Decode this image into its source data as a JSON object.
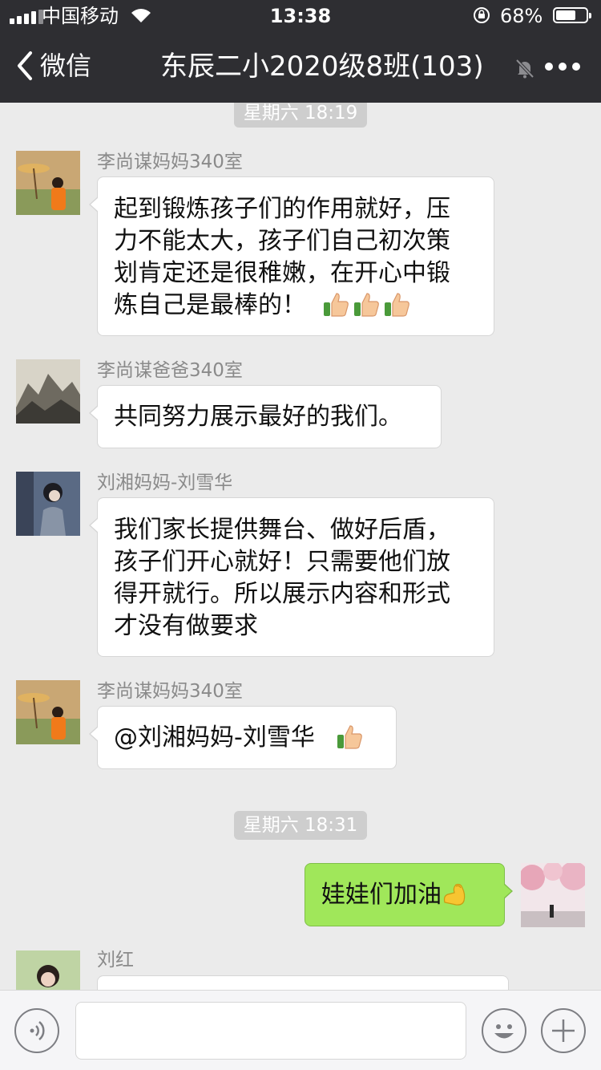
{
  "status_bar": {
    "carrier": "中国移动",
    "time": "13:38",
    "battery_percent": "68%",
    "battery_level": 0.68
  },
  "nav": {
    "back_label": "微信",
    "title": "东辰二小2020级8班(103)"
  },
  "messages": [
    {
      "type": "time",
      "text": "星期六 18:19"
    },
    {
      "type": "incoming",
      "sender": "李尚谋妈妈340室",
      "lines": [
        "起到锻炼孩子们的作用就好，压",
        "力不能太大，孩子们自己初次策",
        "划肯定还是很稚嫩，在开心中锻",
        "炼自己是最棒的！"
      ],
      "emoji": [
        "thumbs-up",
        "thumbs-up",
        "thumbs-up"
      ]
    },
    {
      "type": "incoming",
      "sender": "李尚谋爸爸340室",
      "lines": [
        "共同努力展示最好的我们。"
      ]
    },
    {
      "type": "incoming",
      "sender": "刘湘妈妈-刘雪华",
      "lines": [
        "我们家长提供舞台、做好后盾，",
        "孩子们开心就好！只需要他们放",
        "得开就行。所以展示内容和形式",
        "才没有做要求"
      ]
    },
    {
      "type": "incoming",
      "sender": "李尚谋妈妈340室",
      "lines": [
        "@刘湘妈妈-刘雪华"
      ],
      "emoji": [
        "thumbs-up"
      ]
    },
    {
      "type": "time",
      "text": "星期六 18:31"
    },
    {
      "type": "outgoing",
      "lines": [
        "娃娃们加油"
      ],
      "emoji": [
        "flexed-biceps"
      ]
    },
    {
      "type": "incoming",
      "sender": "刘红",
      "lines": []
    }
  ],
  "input_bar": {
    "voice_icon": "voice-icon",
    "emoji_icon": "smiley-icon",
    "more_icon": "plus-icon"
  },
  "colors": {
    "nav_background": "#2e2e32",
    "chat_background": "#ebebeb",
    "outgoing_bubble": "#a0e75a",
    "incoming_bubble": "#ffffff"
  }
}
